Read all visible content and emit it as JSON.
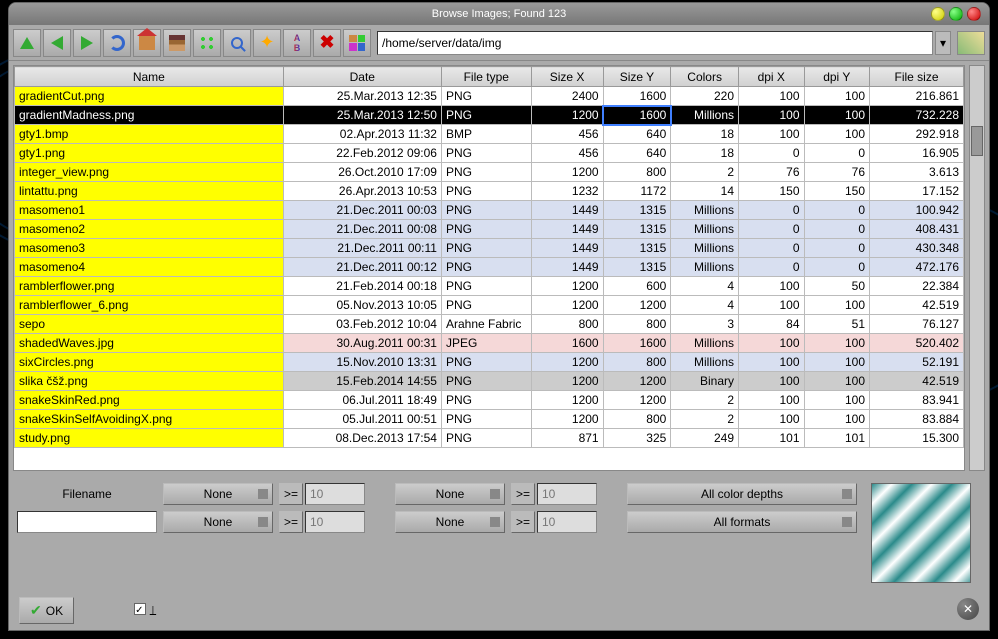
{
  "window": {
    "title": "Browse Images; Found 123"
  },
  "path": "/home/server/data/img",
  "headers": {
    "name": "Name",
    "date": "Date",
    "type": "File type",
    "sizex": "Size X",
    "sizey": "Size Y",
    "colors": "Colors",
    "dpix": "dpi X",
    "dpiy": "dpi Y",
    "filesize": "File size"
  },
  "rows": [
    {
      "name": "gradientCut.png",
      "date": "25.Mar.2013 12:35",
      "type": "PNG",
      "sx": "2400",
      "sy": "1600",
      "colors": "220",
      "dx": "100",
      "dy": "100",
      "fs": "216.861",
      "cls": ""
    },
    {
      "name": "gradientMadness.png",
      "date": "25.Mar.2013 12:50",
      "type": "PNG",
      "sx": "1200",
      "sy": "1600",
      "colors": "Millions",
      "dx": "100",
      "dy": "100",
      "fs": "732.228",
      "cls": "row-sel"
    },
    {
      "name": "gty1.bmp",
      "date": "02.Apr.2013 11:32",
      "type": "BMP",
      "sx": "456",
      "sy": "640",
      "colors": "18",
      "dx": "100",
      "dy": "100",
      "fs": "292.918",
      "cls": ""
    },
    {
      "name": "gty1.png",
      "date": "22.Feb.2012 09:06",
      "type": "PNG",
      "sx": "456",
      "sy": "640",
      "colors": "18",
      "dx": "0",
      "dy": "0",
      "fs": "16.905",
      "cls": ""
    },
    {
      "name": "integer_view.png",
      "date": "26.Oct.2010 17:09",
      "type": "PNG",
      "sx": "1200",
      "sy": "800",
      "colors": "2",
      "dx": "76",
      "dy": "76",
      "fs": "3.613",
      "cls": ""
    },
    {
      "name": "lintattu.png",
      "date": "26.Apr.2013 10:53",
      "type": "PNG",
      "sx": "1232",
      "sy": "1172",
      "colors": "14",
      "dx": "150",
      "dy": "150",
      "fs": "17.152",
      "cls": ""
    },
    {
      "name": "masomeno1",
      "date": "21.Dec.2011 00:03",
      "type": "PNG",
      "sx": "1449",
      "sy": "1315",
      "colors": "Millions",
      "dx": "0",
      "dy": "0",
      "fs": "100.942",
      "cls": "row-blue"
    },
    {
      "name": "masomeno2",
      "date": "21.Dec.2011 00:08",
      "type": "PNG",
      "sx": "1449",
      "sy": "1315",
      "colors": "Millions",
      "dx": "0",
      "dy": "0",
      "fs": "408.431",
      "cls": "row-blue"
    },
    {
      "name": "masomeno3",
      "date": "21.Dec.2011 00:11",
      "type": "PNG",
      "sx": "1449",
      "sy": "1315",
      "colors": "Millions",
      "dx": "0",
      "dy": "0",
      "fs": "430.348",
      "cls": "row-blue"
    },
    {
      "name": "masomeno4",
      "date": "21.Dec.2011 00:12",
      "type": "PNG",
      "sx": "1449",
      "sy": "1315",
      "colors": "Millions",
      "dx": "0",
      "dy": "0",
      "fs": "472.176",
      "cls": "row-blue"
    },
    {
      "name": "ramblerflower.png",
      "date": "21.Feb.2014 00:18",
      "type": "PNG",
      "sx": "1200",
      "sy": "600",
      "colors": "4",
      "dx": "100",
      "dy": "50",
      "fs": "22.384",
      "cls": ""
    },
    {
      "name": "ramblerflower_6.png",
      "date": "05.Nov.2013 10:05",
      "type": "PNG",
      "sx": "1200",
      "sy": "1200",
      "colors": "4",
      "dx": "100",
      "dy": "100",
      "fs": "42.519",
      "cls": ""
    },
    {
      "name": "sepo",
      "date": "03.Feb.2012 10:04",
      "type": "Arahne Fabric",
      "sx": "800",
      "sy": "800",
      "colors": "3",
      "dx": "84",
      "dy": "51",
      "fs": "76.127",
      "cls": ""
    },
    {
      "name": "shadedWaves.jpg",
      "date": "30.Aug.2011 00:31",
      "type": "JPEG",
      "sx": "1600",
      "sy": "1600",
      "colors": "Millions",
      "dx": "100",
      "dy": "100",
      "fs": "520.402",
      "cls": "row-pink"
    },
    {
      "name": "sixCircles.png",
      "date": "15.Nov.2010 13:31",
      "type": "PNG",
      "sx": "1200",
      "sy": "800",
      "colors": "Millions",
      "dx": "100",
      "dy": "100",
      "fs": "52.191",
      "cls": "row-blue"
    },
    {
      "name": "slika čšž.png",
      "date": "15.Feb.2014 14:55",
      "type": "PNG",
      "sx": "1200",
      "sy": "1200",
      "colors": "Binary",
      "dx": "100",
      "dy": "100",
      "fs": "42.519",
      "cls": "row-gray"
    },
    {
      "name": "snakeSkinRed.png",
      "date": "06.Jul.2011 18:49",
      "type": "PNG",
      "sx": "1200",
      "sy": "1200",
      "colors": "2",
      "dx": "100",
      "dy": "100",
      "fs": "83.941",
      "cls": ""
    },
    {
      "name": "snakeSkinSelfAvoidingX.png",
      "date": "05.Jul.2011 00:51",
      "type": "PNG",
      "sx": "1200",
      "sy": "800",
      "colors": "2",
      "dx": "100",
      "dy": "100",
      "fs": "83.884",
      "cls": ""
    },
    {
      "name": "study.png",
      "date": "08.Dec.2013 17:54",
      "type": "PNG",
      "sx": "871",
      "sy": "325",
      "colors": "249",
      "dx": "101",
      "dy": "101",
      "fs": "15.300",
      "cls": ""
    }
  ],
  "filter": {
    "filename_label": "Filename",
    "none": "None",
    "op": ">=",
    "val": "10",
    "colordepths": "All color depths",
    "formats": "All formats"
  },
  "ok": "OK"
}
